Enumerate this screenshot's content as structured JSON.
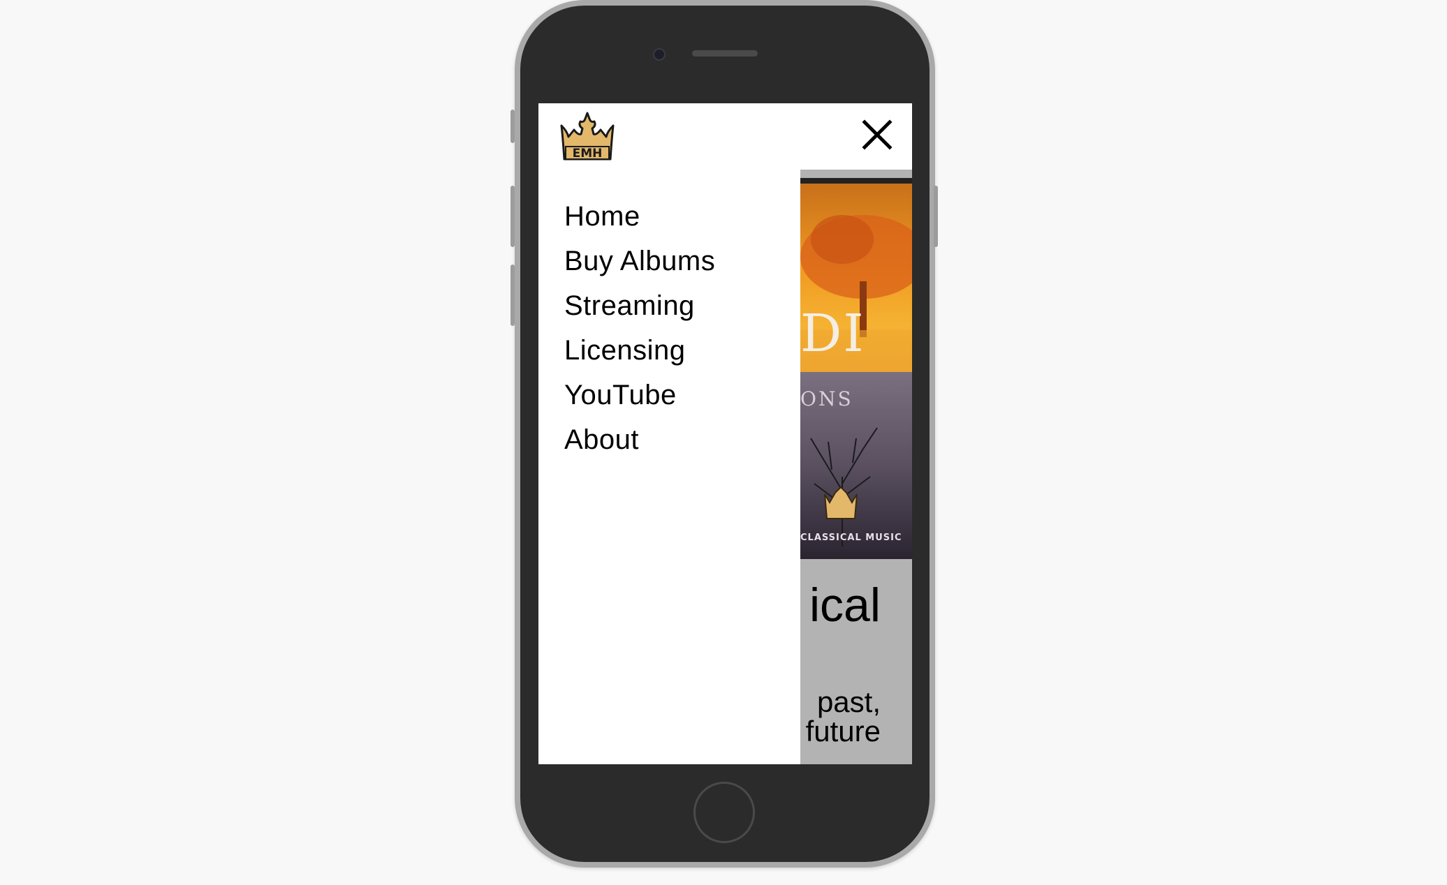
{
  "site": {
    "logo_letters": "EMH",
    "close_icon": "close-icon"
  },
  "nav": {
    "items": [
      {
        "label": "Home"
      },
      {
        "label": "Buy Albums"
      },
      {
        "label": "Streaming"
      },
      {
        "label": "Licensing"
      },
      {
        "label": "YouTube"
      },
      {
        "label": "About"
      }
    ]
  },
  "background": {
    "album_title_fragment": "DI",
    "album_sub_fragment": "ONS",
    "album_footer_fragment": "CLASSICAL MUSIC",
    "heading_fragment": "ical",
    "text_line1": "past,",
    "text_line2": "future"
  },
  "colors": {
    "logo_gold": "#e3b86a",
    "phone_body": "#2b2b2b",
    "overlay_bg": "#b3b3b3"
  }
}
